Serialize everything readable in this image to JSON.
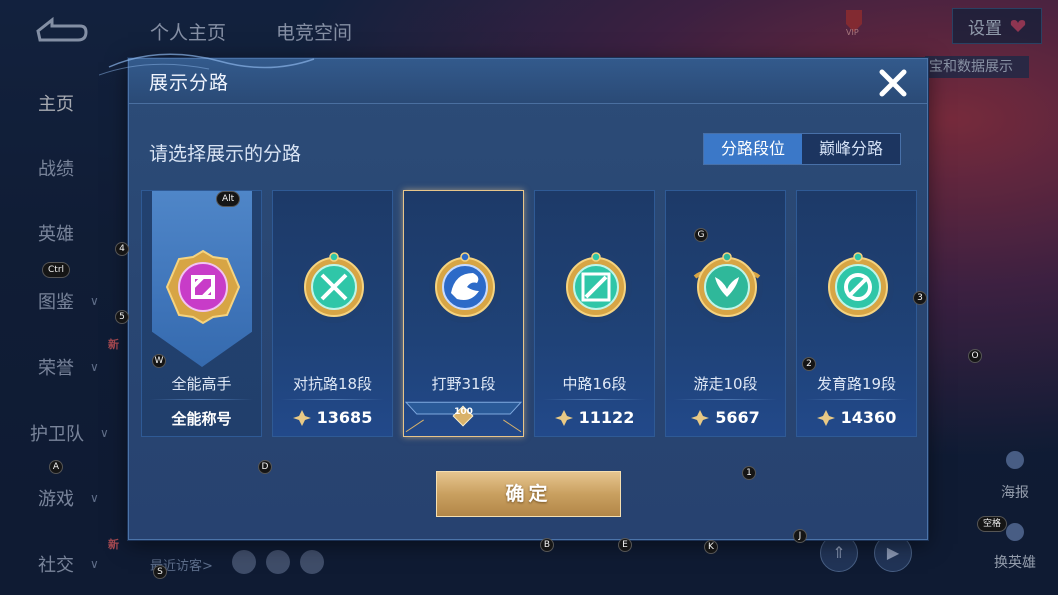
{
  "app": {
    "top_tabs": [
      "个人主页",
      "电竞空间"
    ],
    "side_nav": [
      {
        "label": "主页",
        "active": true
      },
      {
        "label": "战绩"
      },
      {
        "label": "英雄"
      },
      {
        "label": "图鉴",
        "chevron": true
      },
      {
        "label": "荣誉",
        "chevron": true,
        "badge": "新"
      },
      {
        "label": "护卫队",
        "chevron": true
      },
      {
        "label": "游戏",
        "chevron": true
      },
      {
        "label": "社交",
        "chevron": true,
        "badge": "新"
      }
    ],
    "settings_label": "设置",
    "vip_label": "VIP",
    "header_subtitle": "宝和数据展示",
    "recent_visitors": "最近访客>",
    "right_buttons": [
      "海报",
      "换英雄"
    ]
  },
  "dialog": {
    "title": "展示分路",
    "prompt": "请选择展示的分路",
    "toggle": [
      {
        "label": "分路段位",
        "active": true
      },
      {
        "label": "巅峰分路",
        "active": false
      }
    ],
    "confirm_label": "确定",
    "cards": [
      {
        "name": "全能高手",
        "footer": "全能称号",
        "emblem_color": "#c83cc8",
        "type": "allround"
      },
      {
        "name": "对抗路18段",
        "score": "13685",
        "emblem_color": "#2fc6a8"
      },
      {
        "name": "打野31段",
        "badge": "100",
        "emblem_color": "#2c6ac8",
        "selected": true
      },
      {
        "name": "中路16段",
        "score": "11122",
        "emblem_color": "#2fc6a8"
      },
      {
        "name": "游走10段",
        "score": "5667",
        "emblem_color": "#2fb89a"
      },
      {
        "name": "发育路19段",
        "score": "14360",
        "emblem_color": "#2fc6a8"
      }
    ]
  },
  "kbd_hints": {
    "alt": "Alt",
    "ctrl": "Ctrl",
    "w": "W",
    "a": "A",
    "d": "D",
    "s": "S",
    "g": "G",
    "o": "O",
    "b": "B",
    "e": "E",
    "k": "K",
    "j": "J",
    "one": "1",
    "two": "2",
    "three": "3",
    "four": "4",
    "five": "5",
    "space": "空格"
  }
}
